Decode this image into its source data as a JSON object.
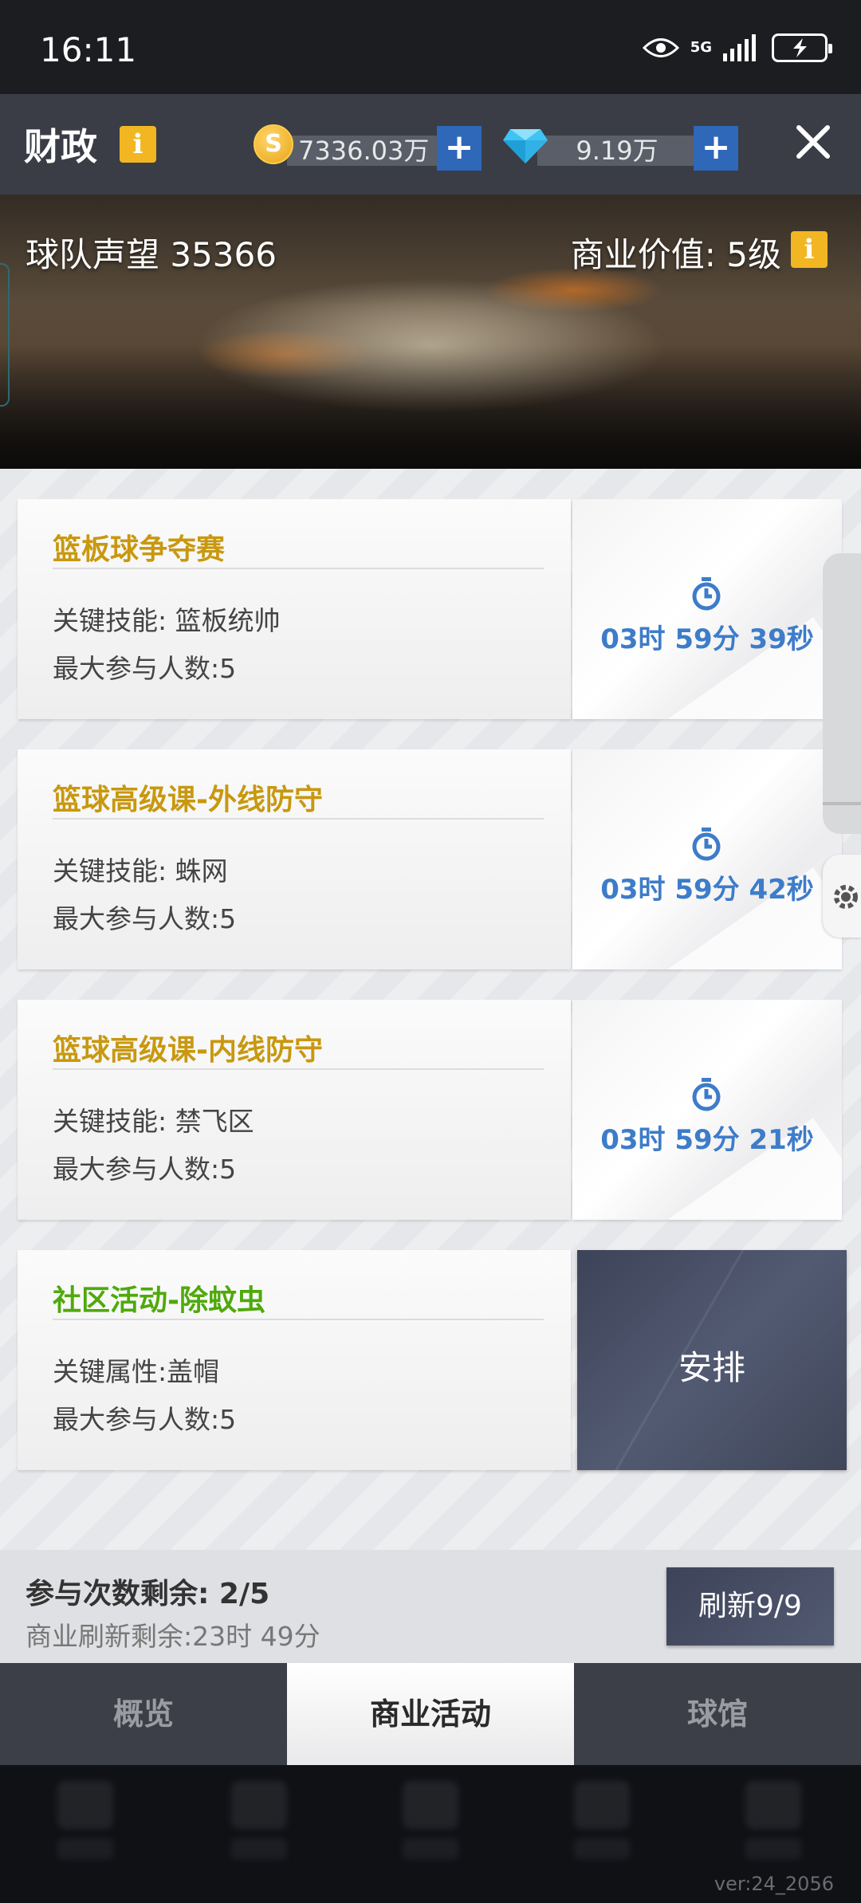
{
  "status_bar": {
    "time": "16:11",
    "network": "5G"
  },
  "header": {
    "title": "财政",
    "coins": "7336.03万",
    "gems": "9.19万"
  },
  "banner": {
    "reputation": "球队声望 35366",
    "commercial_value": "商业价值: 5级"
  },
  "activities": [
    {
      "title": "篮板球争夺赛",
      "skill": "关键技能: 篮板统帅",
      "max_participants": "最大参与人数:5",
      "timer": "03时 59分 39秒",
      "title_color": "#c8980f"
    },
    {
      "title": "篮球高级课-外线防守",
      "skill": "关键技能: 蛛网",
      "max_participants": "最大参与人数:5",
      "timer": "03时 59分 42秒",
      "title_color": "#c8980f"
    },
    {
      "title": "篮球高级课-内线防守",
      "skill": "关键技能: 禁飞区",
      "max_participants": "最大参与人数:5",
      "timer": "03时 59分 21秒",
      "title_color": "#c8980f"
    },
    {
      "title": "社区活动-除蚊虫",
      "skill": "关键属性:盖帽",
      "max_participants": "最大参与人数:5",
      "action": "安排",
      "title_color": "#4fa90b"
    }
  ],
  "bottom_info": {
    "remaining": "参与次数剩余: 2/5",
    "refresh_remaining": "商业刷新剩余:23时 49分",
    "refresh_button": "刷新9/9"
  },
  "tabs": [
    {
      "label": "概览",
      "active": false
    },
    {
      "label": "商业活动",
      "active": true
    },
    {
      "label": "球馆",
      "active": false
    }
  ],
  "version": "ver:24_2056",
  "colors": {
    "accent_blue": "#2f67b9",
    "timer_blue": "#3d7cc9",
    "gold": "#f2b623"
  }
}
